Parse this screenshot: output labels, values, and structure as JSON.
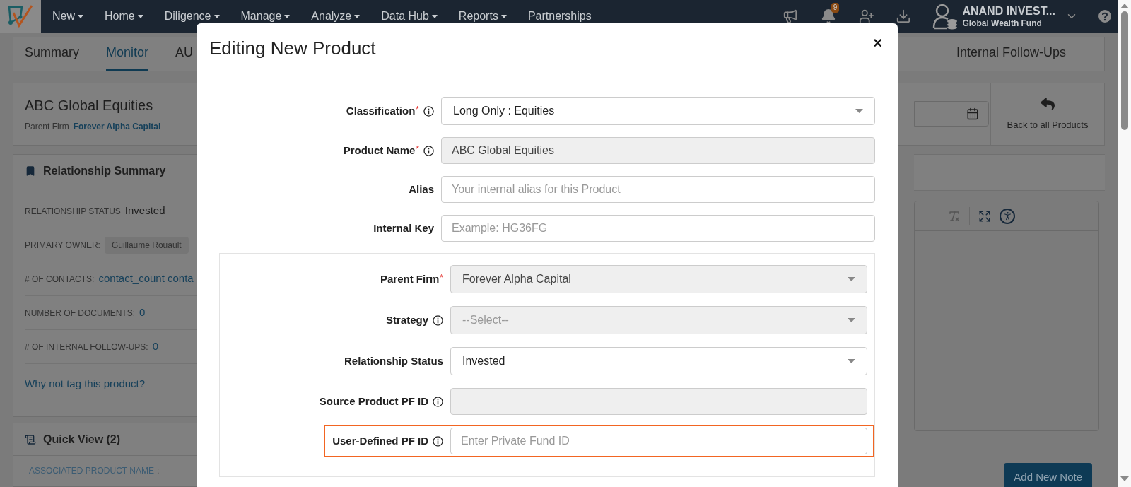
{
  "navbar": {
    "menu": [
      {
        "label": "New",
        "dropdown": true
      },
      {
        "label": "Home",
        "dropdown": true
      },
      {
        "label": "Diligence",
        "dropdown": true
      },
      {
        "label": "Manage",
        "dropdown": true
      },
      {
        "label": "Analyze",
        "dropdown": true
      },
      {
        "label": "Data Hub",
        "dropdown": true
      },
      {
        "label": "Reports",
        "dropdown": true
      },
      {
        "label": "Partnerships",
        "dropdown": false
      }
    ],
    "notification_count": "9",
    "account": {
      "name": "ANAND INVEST...",
      "fund": "Global Wealth Fund"
    }
  },
  "tabs": [
    {
      "label": "Summary",
      "selected": false
    },
    {
      "label": "Monitor",
      "selected": true
    },
    {
      "label": "AU",
      "selected": false
    },
    {
      "label": "Internal Follow-Ups",
      "selected": false
    }
  ],
  "product_header": {
    "name": "ABC Global Equities",
    "parent_firm_label": "Parent Firm",
    "parent_firm": "Forever Alpha Capital",
    "back_link": "Back to all Products"
  },
  "relationship_summary": {
    "title": "Relationship Summary",
    "rows": [
      {
        "kind": "text",
        "label": "RELATIONSHIP STATUS",
        "value": "Invested"
      },
      {
        "kind": "chip",
        "label": "PRIMARY OWNER:",
        "value": "Guillaume Rouault"
      },
      {
        "kind": "link",
        "label": "# OF CONTACTS:",
        "value": "contact_count conta"
      },
      {
        "kind": "link",
        "label": "NUMBER OF DOCUMENTS:",
        "value": "0"
      },
      {
        "kind": "link",
        "label": "# OF INTERNAL FOLLOW-UPS:",
        "value": "0"
      }
    ],
    "tag_link": "Why not tag this product?"
  },
  "quick_view": {
    "title": "Quick View (2)",
    "rows": [
      {
        "label": "ASSOCIATED PRODUCT NAME",
        "separator": ":"
      }
    ]
  },
  "notes": {
    "add_button": "Add New Note"
  },
  "modal": {
    "title": "Editing New Product",
    "close": "×",
    "fields": [
      {
        "kind": "select",
        "label": "Classification",
        "required_mark": "*",
        "info": true,
        "value": "Long Only : Equities",
        "disabled": false,
        "highlighted": false
      },
      {
        "kind": "input",
        "label": "Product Name",
        "required_mark": "*",
        "info": true,
        "value": "ABC Global Equities",
        "disabled": true,
        "highlighted": false
      },
      {
        "kind": "input",
        "label": "Alias",
        "info": false,
        "placeholder": "Your internal alias for this Product",
        "disabled": false,
        "highlighted": false
      },
      {
        "kind": "input",
        "label": "Internal Key",
        "info": false,
        "placeholder": "Example: HG36FG",
        "disabled": false,
        "highlighted": false
      }
    ],
    "group_fields": [
      {
        "kind": "select",
        "label": "Parent Firm",
        "required_mark": "*",
        "info": false,
        "value": "Forever Alpha Capital",
        "disabled": true,
        "highlighted": false
      },
      {
        "kind": "select",
        "label": "Strategy",
        "info": true,
        "placeholder": "--Select--",
        "disabled": true,
        "highlighted": false
      },
      {
        "kind": "select",
        "label": "Relationship Status",
        "info": false,
        "value": "Invested",
        "disabled": false,
        "highlighted": false
      },
      {
        "kind": "input",
        "label": "Source Product PF ID",
        "info": true,
        "disabled": true,
        "highlighted": false
      },
      {
        "kind": "input",
        "label": "User-Defined PF ID",
        "info": true,
        "placeholder": "Enter Private Fund ID",
        "disabled": false,
        "highlighted": true
      }
    ]
  }
}
